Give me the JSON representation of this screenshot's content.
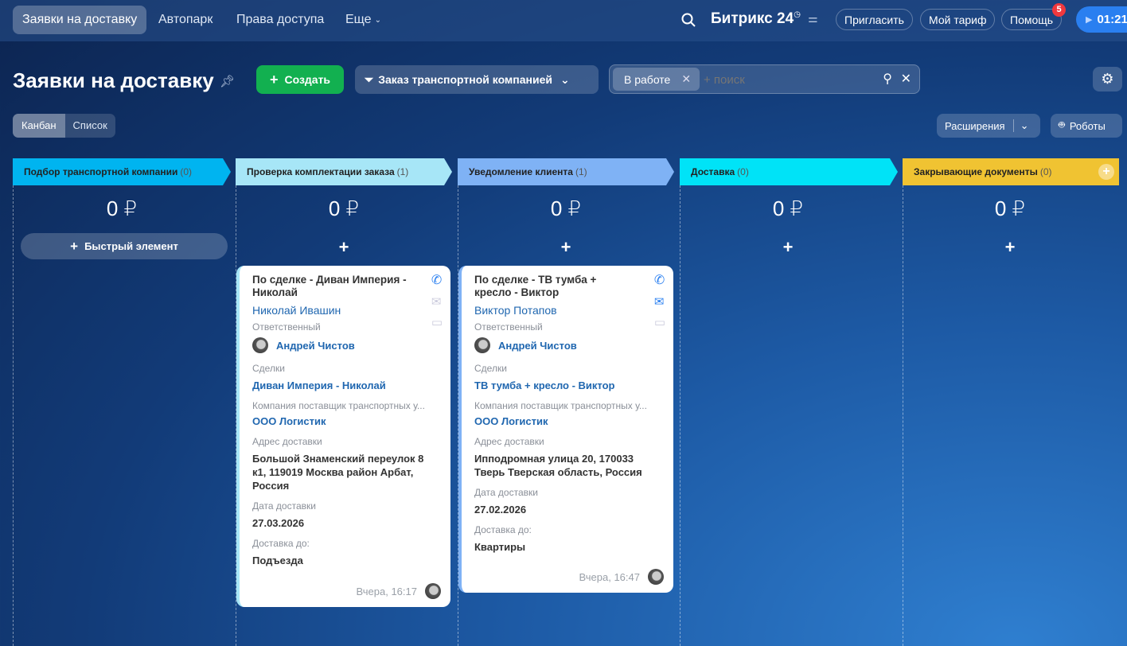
{
  "topnav": {
    "items": [
      "Заявки на доставку",
      "Автопарк",
      "Права доступа",
      "Еще"
    ],
    "brand": "Битрикс",
    "brand_num": "24",
    "invite": "Пригласить",
    "tariff": "Мой тариф",
    "help": "Помощь",
    "help_badge": "5",
    "timer": "01:21"
  },
  "header": {
    "title": "Заявки на доставку",
    "create": "Создать",
    "funnel": "Заказ транспортной компанией",
    "filter_tag": "В работе",
    "search_placeholder": "+ поиск"
  },
  "views": {
    "kanban": "Канбан",
    "list": "Список",
    "extensions": "Расширения",
    "robots": "Роботы"
  },
  "columns": [
    {
      "title": "Подбор транспортной компании",
      "count": "(0)",
      "sum": "0 ₽",
      "color": "#00b4f0"
    },
    {
      "title": "Проверка комплектации заказа",
      "count": "(1)",
      "sum": "0 ₽",
      "color": "#a7e6f7"
    },
    {
      "title": "Уведомление клиента",
      "count": "(1)",
      "sum": "0 ₽",
      "color": "#7fb2f5"
    },
    {
      "title": "Доставка",
      "count": "(0)",
      "sum": "0 ₽",
      "color": "#00e3f7"
    },
    {
      "title": "Закрывающие документы",
      "count": "(0)",
      "sum": "0 ₽",
      "color": "#f0c332"
    }
  ],
  "quick_add": "Быстрый элемент",
  "plus": "+",
  "cards": [
    {
      "title": "По сделке - Диван Империя - Николай",
      "contact": "Николай Ивашин",
      "resp_label": "Ответственный",
      "resp": "Андрей Чистов",
      "deals_label": "Сделки",
      "deal": "Диван Империя - Николай",
      "company_label": "Компания поставщик транспортных у...",
      "company": "ООО Логистик",
      "addr_label": "Адрес доставки",
      "addr": "Большой Знаменский переулок 8 к1, 119019 Москва район Арбат, Россия",
      "date_label": "Дата доставки",
      "date": "27.03.2026",
      "to_label": "Доставка до:",
      "to": "Подъезда",
      "time": "Вчера, 16:17"
    },
    {
      "title": "По сделке - ТВ тумба + кресло - Виктор",
      "contact": "Виктор Потапов",
      "resp_label": "Ответственный",
      "resp": "Андрей Чистов",
      "deals_label": "Сделки",
      "deal": "ТВ тумба + кресло - Виктор",
      "company_label": "Компания поставщик транспортных у...",
      "company": "ООО Логистик",
      "addr_label": "Адрес доставки",
      "addr": "Ипподромная улица 20, 170033 Тверь Тверская область, Россия",
      "date_label": "Дата доставки",
      "date": "27.02.2026",
      "to_label": "Доставка до:",
      "to": "Квартиры",
      "time": "Вчера, 16:47"
    }
  ]
}
